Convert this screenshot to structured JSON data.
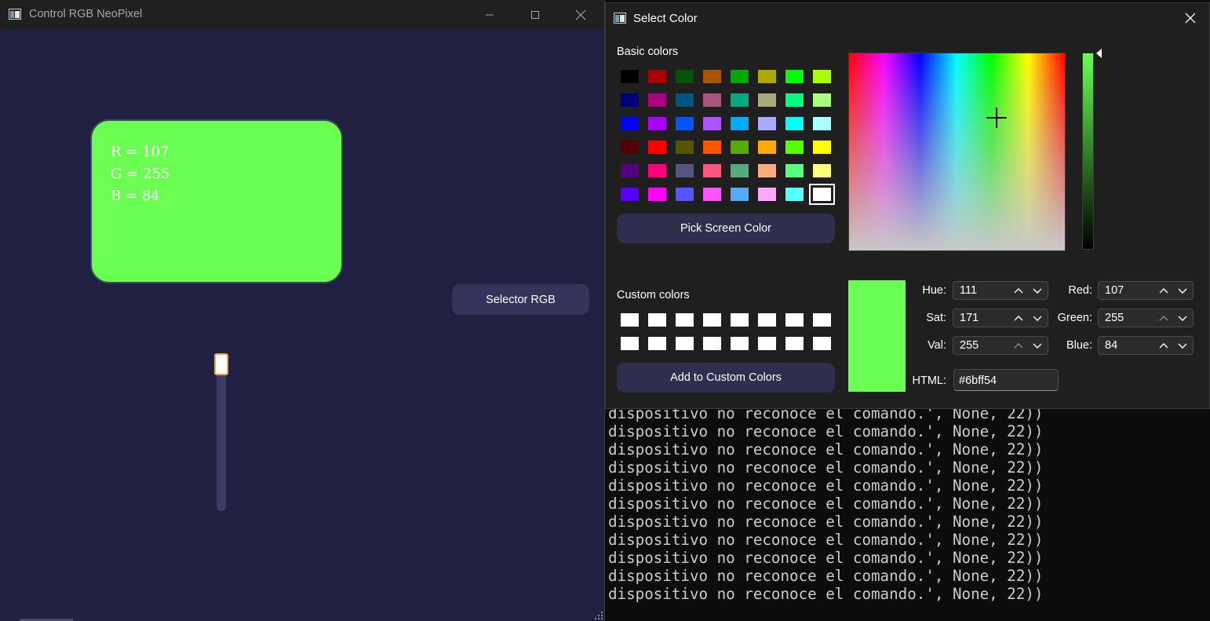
{
  "terminal": {
    "lines": [
      "dispositivo no reconoce el comando.', None, 22))",
      "dispositivo no reconoce el comando.', None, 22))",
      "dispositivo no reconoce el comando.', None, 22))",
      "dispositivo no reconoce el comando.', None, 22))",
      "dispositivo no reconoce el comando.', None, 22))",
      "dispositivo no reconoce el comando.', None, 22))",
      "dispositivo no reconoce el comando.', None, 22))",
      "dispositivo no reconoce el comando.', None, 22))",
      "dispositivo no reconoce el comando.', None, 22))",
      "dispositivo no reconoce el comando.', None, 22))",
      "dispositivo no reconoce el comando.', None, 22))"
    ]
  },
  "main_window": {
    "title": "Control RGB NeoPixel",
    "rgb_lines": [
      "R = 107",
      "G = 255",
      "B = 84"
    ],
    "card_color": "#6bff54",
    "selector_button_label": "Selector RGB",
    "slider_value": 1.0
  },
  "dialog": {
    "title": "Select Color",
    "basic_colors_label": "Basic colors",
    "basic_colors": [
      [
        "#000000",
        "#aa0000",
        "#005500",
        "#aa5500",
        "#00aa00",
        "#aaaa00",
        "#00ff00",
        "#aaff00"
      ],
      [
        "#00007f",
        "#aa007f",
        "#00557f",
        "#aa557f",
        "#00aa7f",
        "#aaaa7f",
        "#00ff7f",
        "#aaff7f"
      ],
      [
        "#0000ff",
        "#aa00ff",
        "#0055ff",
        "#aa55ff",
        "#00aaff",
        "#aaaaff",
        "#00ffff",
        "#aaffff"
      ],
      [
        "#550000",
        "#ff0000",
        "#555500",
        "#ff5500",
        "#55aa00",
        "#ffaa00",
        "#55ff00",
        "#ffff00"
      ],
      [
        "#55007f",
        "#ff007f",
        "#55557f",
        "#ff557f",
        "#55aa7f",
        "#ffaa7f",
        "#55ff7f",
        "#ffff7f"
      ],
      [
        "#5500ff",
        "#ff00ff",
        "#5555ff",
        "#ff55ff",
        "#55aaff",
        "#ffaaff",
        "#55ffff",
        "#ffffff"
      ]
    ],
    "pick_screen_label": "Pick Screen Color",
    "custom_colors_label": "Custom colors",
    "custom_colors": [
      [
        "#ffffff",
        "#ffffff",
        "#ffffff",
        "#ffffff",
        "#ffffff",
        "#ffffff",
        "#ffffff",
        "#ffffff"
      ],
      [
        "#ffffff",
        "#ffffff",
        "#ffffff",
        "#ffffff",
        "#ffffff",
        "#ffffff",
        "#ffffff",
        "#ffffff"
      ]
    ],
    "add_custom_label": "Add to Custom Colors",
    "current_color": "#6bff54",
    "fields": {
      "hue": {
        "label": "Hue:",
        "value": "111"
      },
      "sat": {
        "label": "Sat:",
        "value": "171"
      },
      "val": {
        "label": "Val:",
        "value": "255"
      },
      "red": {
        "label": "Red:",
        "value": "107"
      },
      "green": {
        "label": "Green:",
        "value": "255"
      },
      "blue": {
        "label": "Blue:",
        "value": "84"
      }
    },
    "html_label": "HTML:",
    "html_value": "#6bff54"
  }
}
